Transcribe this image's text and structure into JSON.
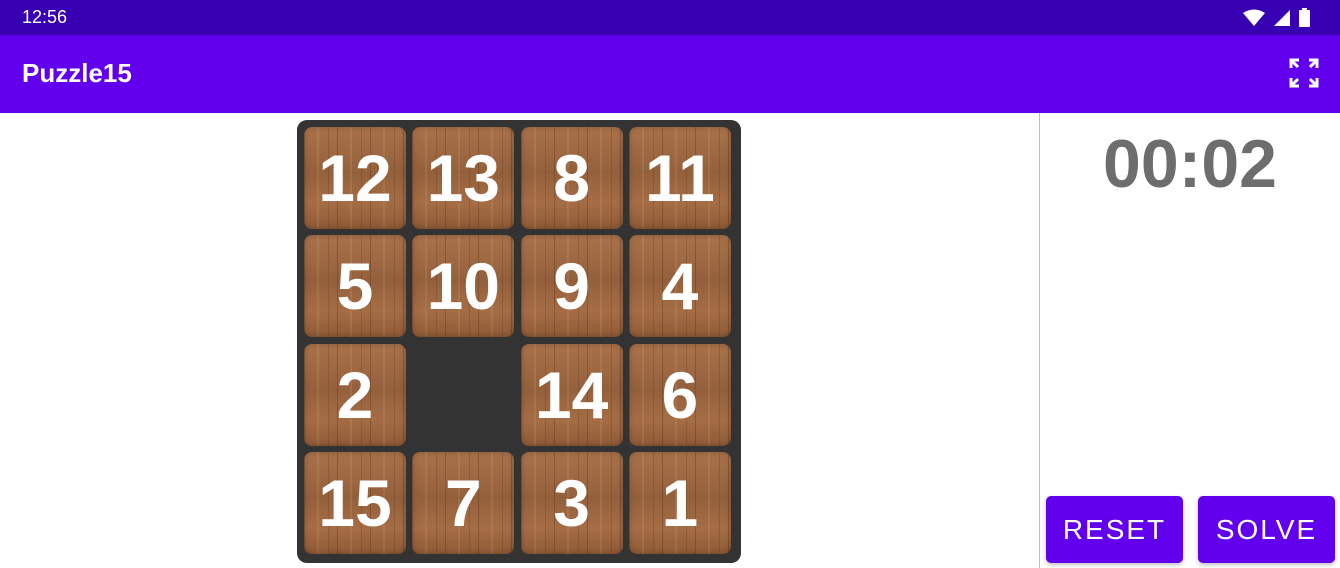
{
  "status_bar": {
    "time": "12:56"
  },
  "app_bar": {
    "title": "Puzzle15",
    "fullscreen_icon": "fullscreen-icon"
  },
  "board": {
    "grid": [
      [
        "12",
        "13",
        "8",
        "11"
      ],
      [
        "5",
        "10",
        "9",
        "4"
      ],
      [
        "2",
        "",
        "14",
        "6"
      ],
      [
        "15",
        "7",
        "3",
        "1"
      ]
    ],
    "empty_cell": {
      "row": 3,
      "col": 2
    }
  },
  "timer": "00:02",
  "buttons": {
    "reset": "RESET",
    "solve": "SOLVE"
  },
  "colors": {
    "status_bar": "#3700b3",
    "app_bar": "#6200ee",
    "board": "#333333",
    "tile_wood": "#9b6640",
    "timer_text": "#6d6d6d",
    "button": "#6200ee"
  }
}
